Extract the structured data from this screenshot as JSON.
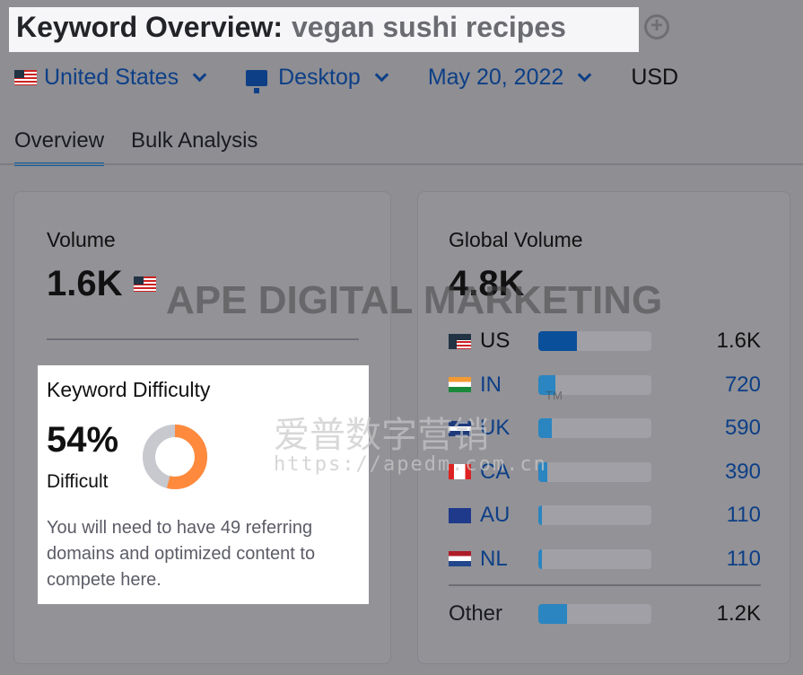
{
  "header": {
    "title": "Keyword Overview:",
    "keyword": "vegan sushi recipes",
    "add_icon": "plus-circle-icon"
  },
  "filters": {
    "country": "United States",
    "device": "Desktop",
    "date": "May 20, 2022",
    "currency": "USD"
  },
  "tabs": [
    {
      "label": "Overview",
      "active": true
    },
    {
      "label": "Bulk Analysis",
      "active": false
    }
  ],
  "volume": {
    "label": "Volume",
    "value": "1.6K"
  },
  "keyword_difficulty": {
    "label": "Keyword Difficulty",
    "value": "54%",
    "percent": 54,
    "level": "Difficult",
    "description": "You will need to have 49 referring domains and optimized content to compete here.",
    "color": "#ff8a3d"
  },
  "global_volume": {
    "label": "Global Volume",
    "value": "4.8K",
    "countries": [
      {
        "code": "US",
        "value": "1.6K",
        "share": 0.34,
        "color": "#0a4f9a"
      },
      {
        "code": "IN",
        "value": "720",
        "share": 0.15,
        "color": "#2a85c0"
      },
      {
        "code": "UK",
        "value": "590",
        "share": 0.12,
        "color": "#2a85c0"
      },
      {
        "code": "CA",
        "value": "390",
        "share": 0.08,
        "color": "#2a85c0"
      },
      {
        "code": "AU",
        "value": "110",
        "share": 0.03,
        "color": "#2a85c0"
      },
      {
        "code": "NL",
        "value": "110",
        "share": 0.03,
        "color": "#2a85c0"
      }
    ],
    "other": {
      "label": "Other",
      "value": "1.2K",
      "share": 0.25
    }
  },
  "watermark": {
    "brand": "APE DIGITAL MARKETING",
    "chinese": "爱普数字营销",
    "url": "https://apedm.com.cn",
    "tm": "TM"
  }
}
